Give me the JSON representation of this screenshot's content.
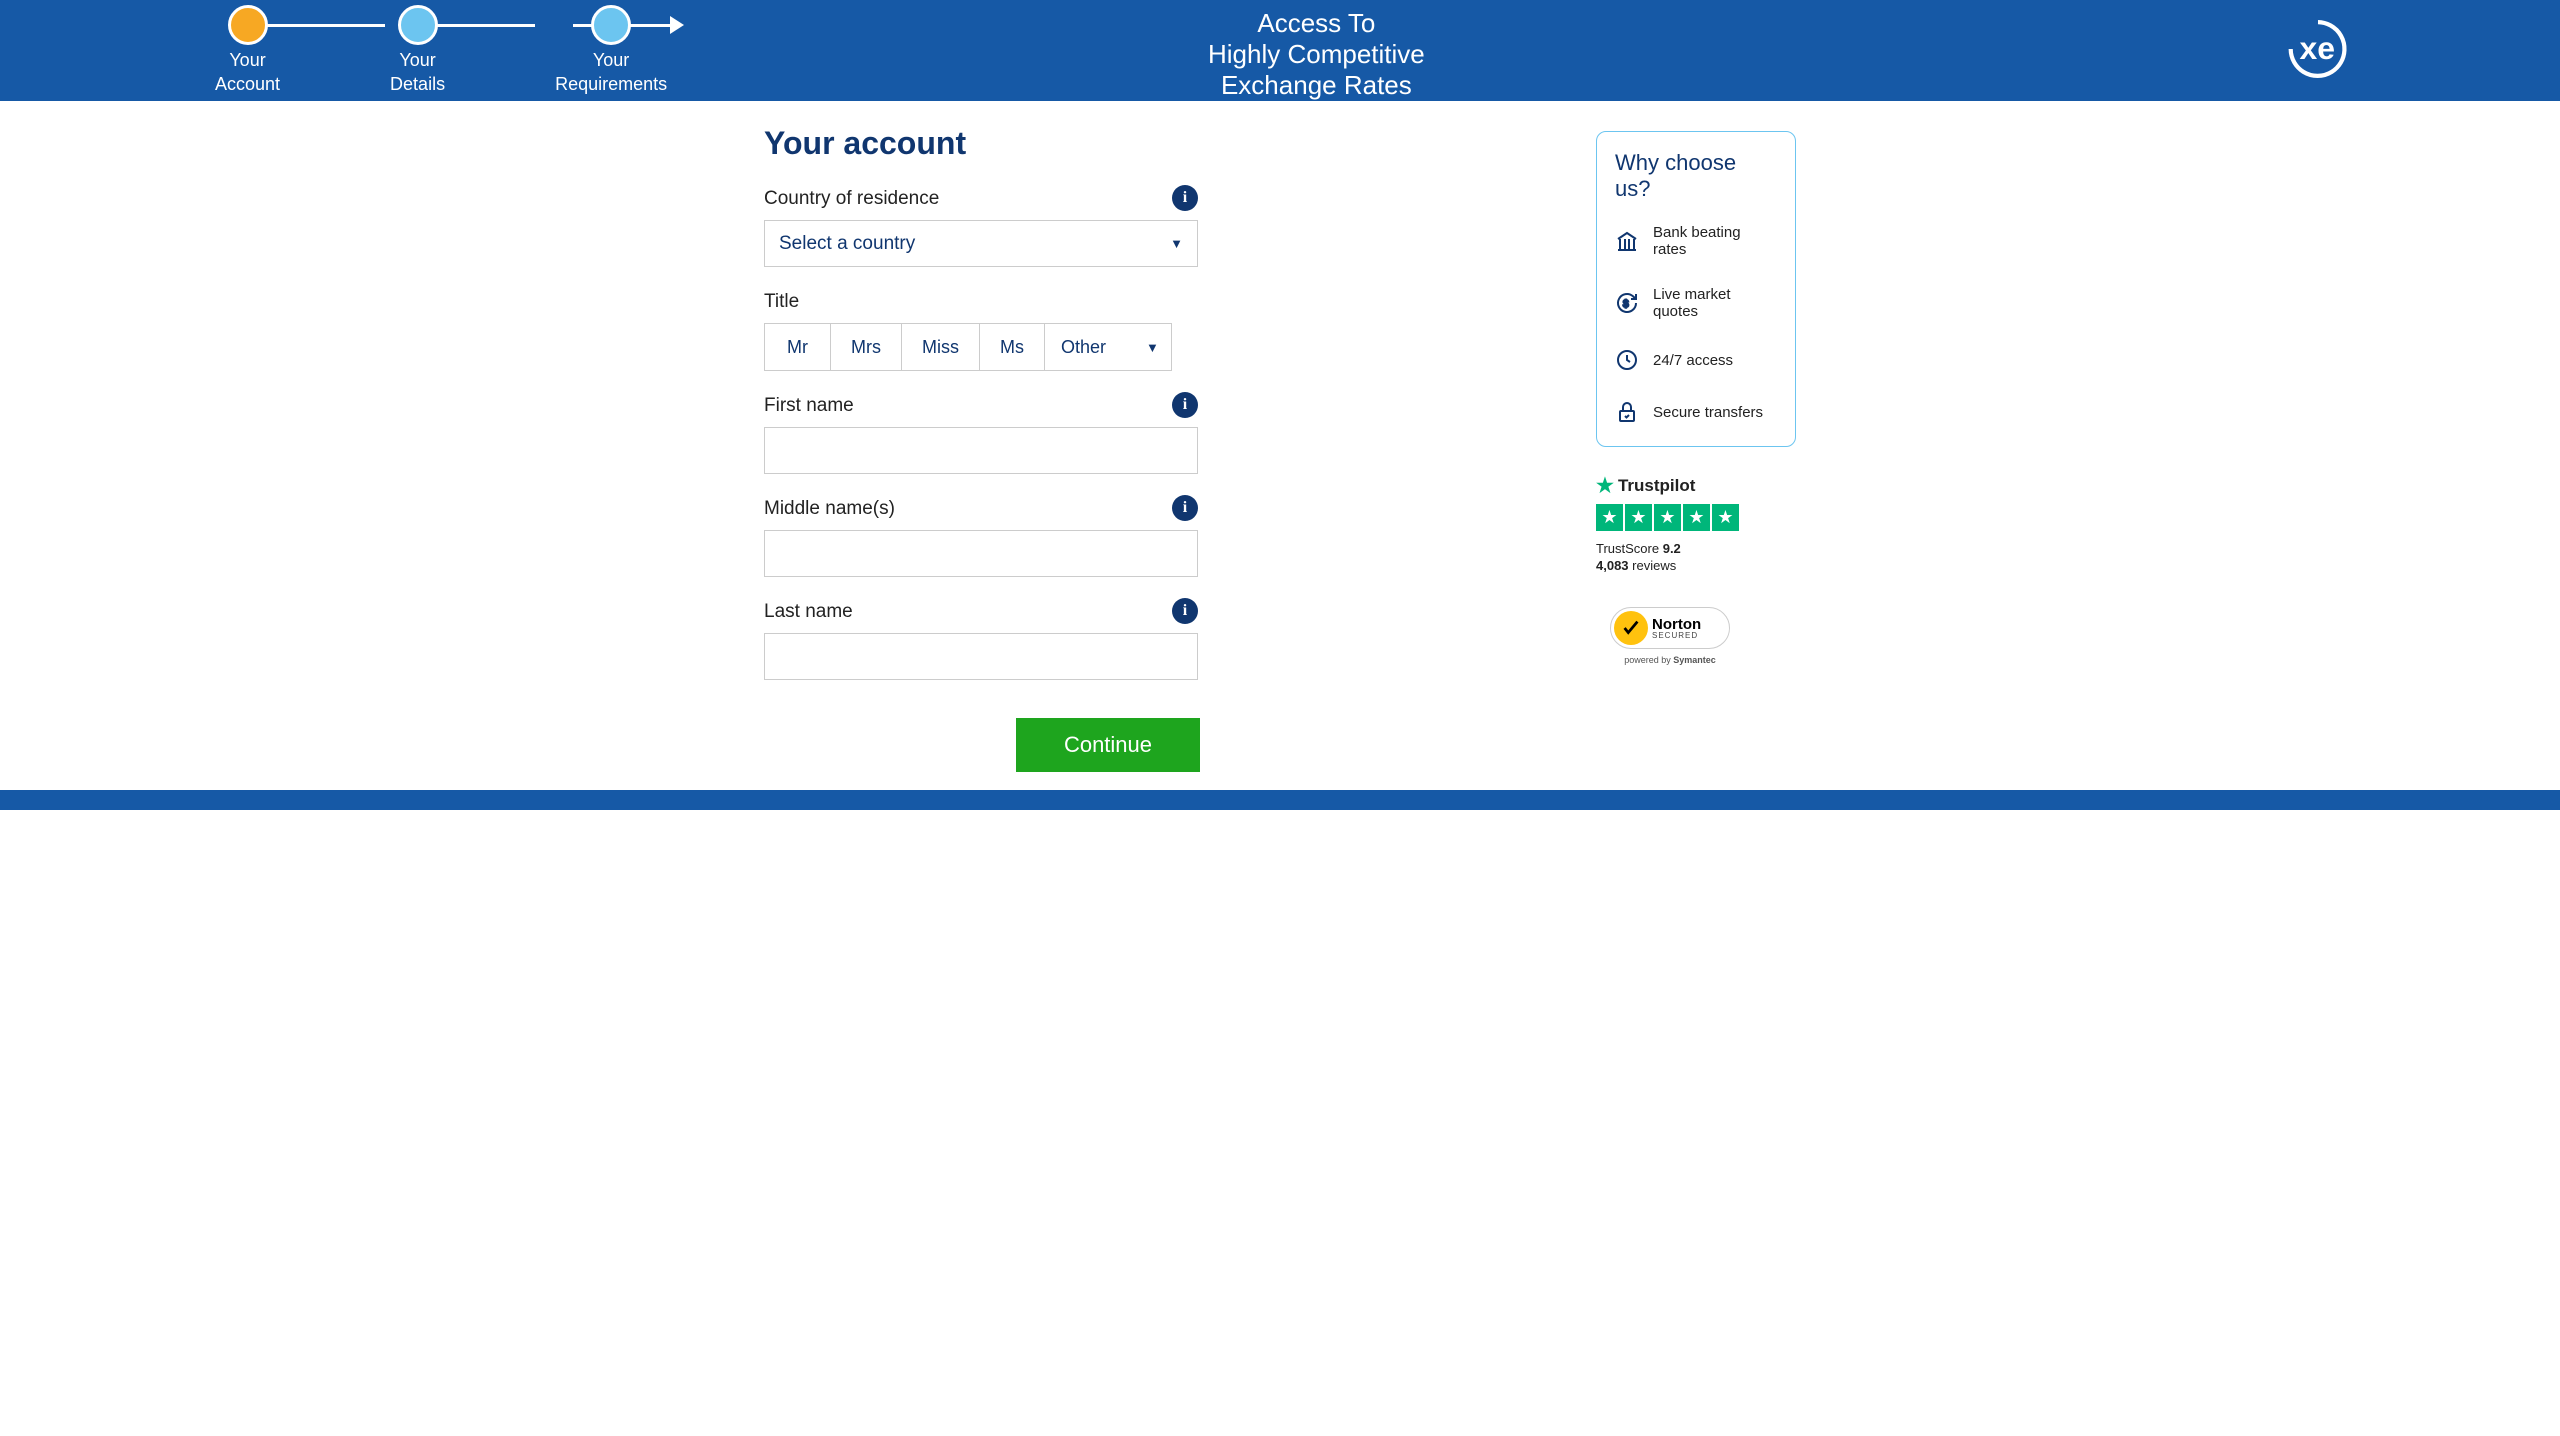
{
  "header": {
    "steps": [
      {
        "label_line1": "Your",
        "label_line2": "Account"
      },
      {
        "label_line1": "Your",
        "label_line2": "Details"
      },
      {
        "label_line1": "Your",
        "label_line2": "Requirements"
      }
    ],
    "tagline_line1": "Access To",
    "tagline_line2": "Highly Competitive",
    "tagline_line3": "Exchange Rates",
    "logo_text": "xe"
  },
  "form": {
    "title": "Your account",
    "country": {
      "label": "Country of residence",
      "placeholder": "Select a country"
    },
    "title_field": {
      "label": "Title",
      "options": [
        "Mr",
        "Mrs",
        "Miss",
        "Ms"
      ],
      "other_label": "Other"
    },
    "first_name": {
      "label": "First name",
      "value": ""
    },
    "middle_name": {
      "label": "Middle name(s)",
      "value": ""
    },
    "last_name": {
      "label": "Last name",
      "value": ""
    },
    "continue_label": "Continue"
  },
  "sidebar": {
    "why_title": "Why choose us?",
    "items": [
      "Bank beating rates",
      "Live market quotes",
      "24/7 access",
      "Secure transfers"
    ],
    "trustpilot": {
      "brand": "Trustpilot",
      "score_label": "TrustScore",
      "score": "9.2",
      "reviews_count": "4,083",
      "reviews_label": "reviews"
    },
    "norton": {
      "name": "Norton",
      "secured": "SECURED",
      "powered_label": "powered by",
      "powered_brand": "Symantec"
    }
  }
}
